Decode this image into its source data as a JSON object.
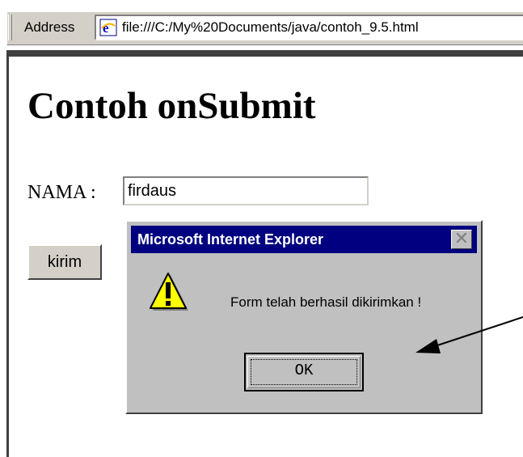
{
  "address_bar": {
    "label": "Address",
    "url": "file:///C:/My%20Documents/java/contoh_9.5.html"
  },
  "page": {
    "heading": "Contoh onSubmit",
    "nama_label": "NAMA :",
    "nama_value": "firdaus",
    "submit_label": "kirim"
  },
  "dialog": {
    "title": "Microsoft Internet Explorer",
    "close_glyph": "✕",
    "message": "Form telah berhasil dikirimkan !",
    "ok_label": "OK",
    "icon": "warning-icon"
  },
  "colors": {
    "titlebar": "#000080",
    "dialog_bg": "#c0c0c0",
    "warning_fill": "#ffff00"
  }
}
